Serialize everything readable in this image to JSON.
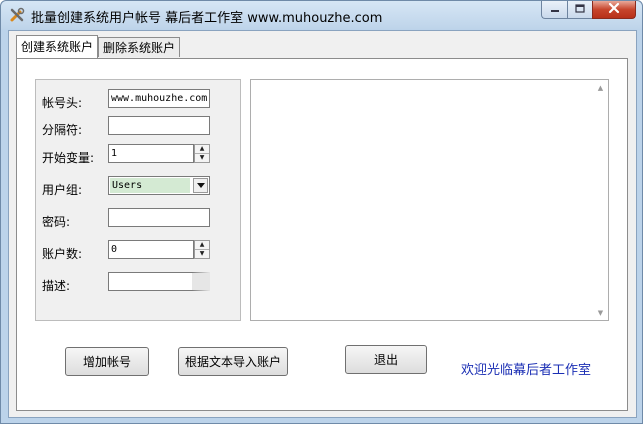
{
  "window": {
    "title": "批量创建系统用户帐号  幕后者工作室  www.muhouzhe.com",
    "controls": [
      "minimize-icon",
      "maximize-icon",
      "close-icon"
    ],
    "close_color": "#c7452c"
  },
  "tabs": [
    {
      "label": "创建系统账户",
      "active": true
    },
    {
      "label": "删除系统账户",
      "active": false
    }
  ],
  "form": {
    "account_prefix": {
      "label": "帐号头:",
      "value": "www.muhouzhe.com"
    },
    "separator": {
      "label": "分隔符:",
      "value": ""
    },
    "start_var": {
      "label": "开始变量:",
      "value": "1"
    },
    "user_group": {
      "label": "用户组:",
      "value": "Users",
      "highlight_color": "#d4ead3"
    },
    "password": {
      "label": "密码:",
      "value": ""
    },
    "account_count": {
      "label": "账户数:",
      "value": "0"
    },
    "description": {
      "label": "描述:",
      "value": ""
    }
  },
  "buttons": {
    "add_account": "增加帐号",
    "import_from_text": "根据文本导入账户",
    "exit": "退出"
  },
  "welcome": {
    "text": "欢迎光临幕后者工作室",
    "color": "#1b2fb4"
  }
}
